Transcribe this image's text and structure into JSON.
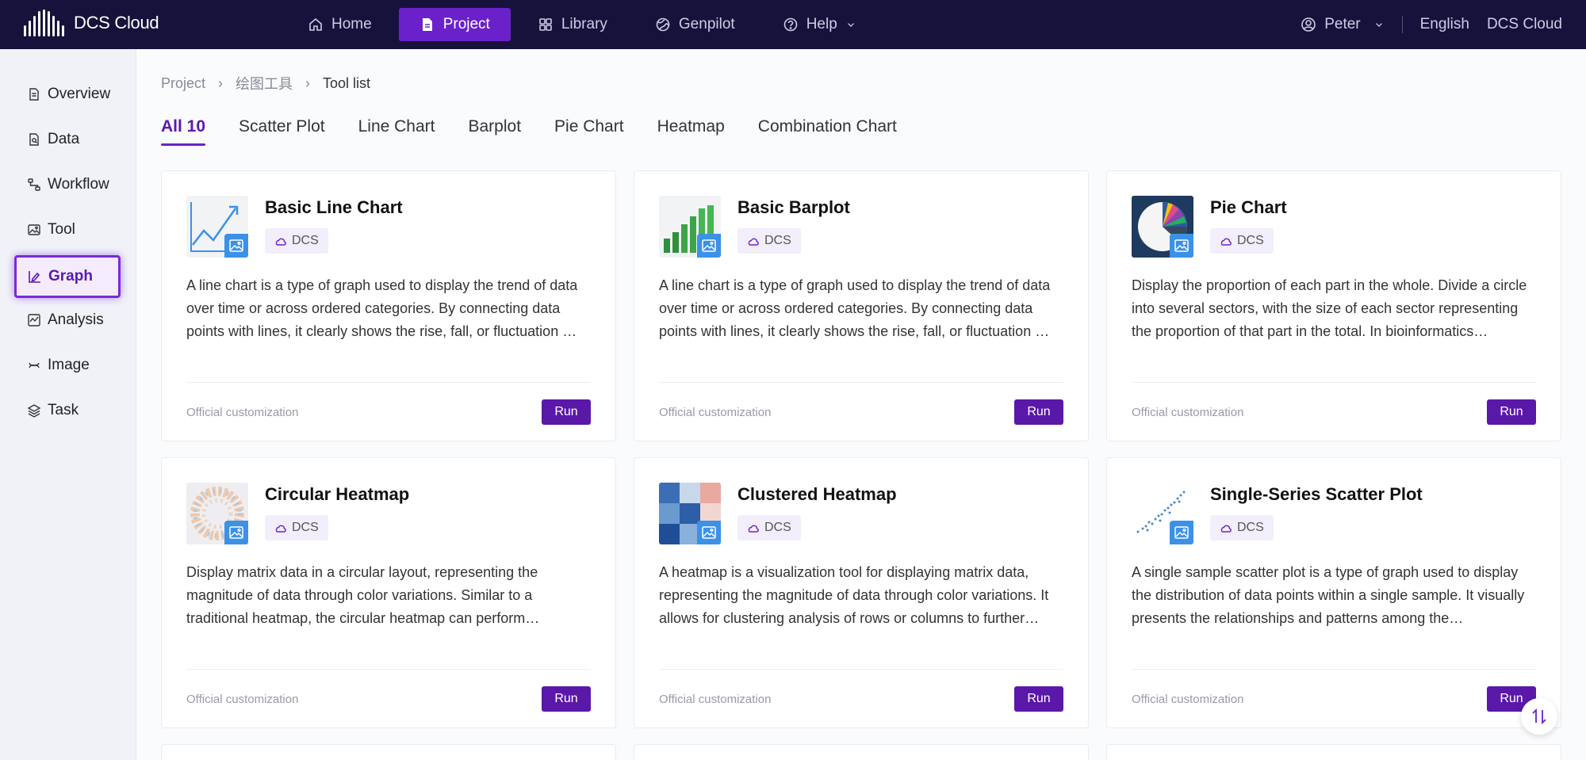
{
  "app": {
    "name": "DCS Cloud"
  },
  "nav": {
    "items": [
      {
        "label": "Home",
        "icon": "home-icon"
      },
      {
        "label": "Project",
        "icon": "file-icon",
        "active": true
      },
      {
        "label": "Library",
        "icon": "grid-icon"
      },
      {
        "label": "Genpilot",
        "icon": "globe-icon"
      },
      {
        "label": "Help",
        "icon": "help-icon"
      }
    ]
  },
  "user": {
    "name": "Peter",
    "language": "English",
    "platform": "DCS Cloud"
  },
  "sidebar": {
    "items": [
      {
        "label": "Overview",
        "icon": "document-icon"
      },
      {
        "label": "Data",
        "icon": "file-search-icon"
      },
      {
        "label": "Workflow",
        "icon": "workflow-icon"
      },
      {
        "label": "Tool",
        "icon": "image-icon"
      },
      {
        "label": "Graph",
        "icon": "graph-edit-icon",
        "active": true
      },
      {
        "label": "Analysis",
        "icon": "analysis-icon"
      },
      {
        "label": "Image",
        "icon": "dna-icon"
      },
      {
        "label": "Task",
        "icon": "layers-icon"
      }
    ]
  },
  "breadcrumb": {
    "items": [
      "Project",
      "绘图工具",
      "Tool list"
    ]
  },
  "tabs": [
    {
      "label": "All 10",
      "active": true
    },
    {
      "label": "Scatter Plot"
    },
    {
      "label": "Line Chart"
    },
    {
      "label": "Barplot"
    },
    {
      "label": "Pie Chart"
    },
    {
      "label": "Heatmap"
    },
    {
      "label": "Combination Chart"
    }
  ],
  "cards": [
    {
      "title": "Basic Line Chart",
      "tag": "DCS",
      "thumb": "line-chart-thumbnail",
      "description": "A line chart is a type of graph used to display the trend of data over time or across ordered categories. By connecting data points with lines, it clearly shows the rise, fall, or fluctuation …",
      "footer": "Official customization",
      "button": "Run"
    },
    {
      "title": "Basic Barplot",
      "tag": "DCS",
      "thumb": "barplot-thumbnail",
      "description": "A line chart is a type of graph used to display the trend of data over time or across ordered categories. By connecting data points with lines, it clearly shows the rise, fall, or fluctuation …",
      "footer": "Official customization",
      "button": "Run"
    },
    {
      "title": "Pie Chart",
      "tag": "DCS",
      "thumb": "pie-chart-thumbnail",
      "description": "Display the proportion of each part in the whole. Divide a circle into several sectors, with the size of each sector representing the proportion of that part in the total. In bioinformatics…",
      "footer": "Official customization",
      "button": "Run"
    },
    {
      "title": "Circular Heatmap",
      "tag": "DCS",
      "thumb": "circular-heatmap-thumbnail",
      "description": "Display matrix data in a circular layout, representing the magnitude of data through color variations. Similar to a traditional heatmap, the circular heatmap can perform…",
      "footer": "Official customization",
      "button": "Run"
    },
    {
      "title": "Clustered Heatmap",
      "tag": "DCS",
      "thumb": "clustered-heatmap-thumbnail",
      "description": "A heatmap is a visualization tool for displaying matrix data, representing the magnitude of data through color variations. It allows for clustering analysis of rows or columns to further…",
      "footer": "Official customization",
      "button": "Run"
    },
    {
      "title": "Single-Series Scatter Plot",
      "tag": "DCS",
      "thumb": "scatter-plot-thumbnail",
      "description": "A single sample scatter plot is a type of graph used to display the distribution of data points within a single sample. It visually presents the relationships and patterns among the…",
      "footer": "Official customization",
      "button": "Run"
    }
  ],
  "colors": {
    "topbar": "#16123b",
    "accent": "#6b21c9",
    "run_button": "#5a18a8"
  }
}
